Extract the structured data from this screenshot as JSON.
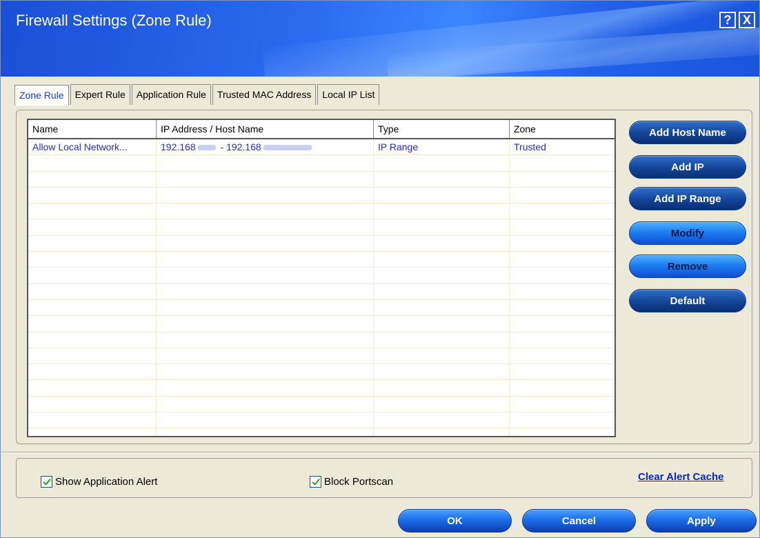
{
  "window": {
    "title": "Firewall Settings (Zone Rule)",
    "help_label": "?",
    "close_label": "X"
  },
  "tabs": [
    {
      "label": "Zone Rule",
      "active": true
    },
    {
      "label": "Expert Rule",
      "active": false
    },
    {
      "label": "Application Rule",
      "active": false
    },
    {
      "label": "Trusted MAC Address",
      "active": false
    },
    {
      "label": "Local IP List",
      "active": false
    }
  ],
  "table": {
    "columns": [
      "Name",
      "IP Address / Host Name",
      "Type",
      "Zone"
    ],
    "rows": [
      {
        "name": "Allow Local Network...",
        "ip_start": "192.168",
        "ip_sep": " - ",
        "ip_end": "192.168",
        "type": "IP Range",
        "zone": "Trusted"
      }
    ]
  },
  "side_buttons": {
    "add_host_name": "Add Host Name",
    "add_ip": "Add IP",
    "add_ip_range": "Add IP Range",
    "modify": "Modify",
    "remove": "Remove",
    "default": "Default"
  },
  "options": {
    "show_application_alert": {
      "label": "Show Application Alert",
      "checked": true
    },
    "block_portscan": {
      "label": "Block Portscan",
      "checked": true
    },
    "clear_alert_cache": "Clear Alert Cache"
  },
  "footer": {
    "ok": "OK",
    "cancel": "Cancel",
    "apply": "Apply"
  }
}
